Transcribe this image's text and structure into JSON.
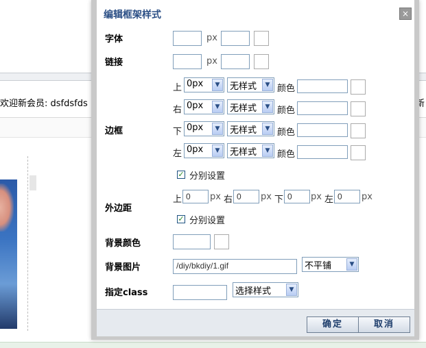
{
  "background": {
    "welcome_text": "欢迎新会员: dsfdsfds",
    "right_edge_text": "新"
  },
  "dialog": {
    "title": "编辑框架样式",
    "close_glyph": "×",
    "font": {
      "label": "字体",
      "unit": "px"
    },
    "link": {
      "label": "链接",
      "unit": "px"
    },
    "border": {
      "label": "边框",
      "rows": [
        {
          "side": "上",
          "size": "0px",
          "style": "无样式",
          "color_label": "颜色"
        },
        {
          "side": "右",
          "size": "0px",
          "style": "无样式",
          "color_label": "颜色"
        },
        {
          "side": "下",
          "size": "0px",
          "style": "无样式",
          "color_label": "颜色"
        },
        {
          "side": "左",
          "size": "0px",
          "style": "无样式",
          "color_label": "颜色"
        }
      ],
      "separate_label": "分别设置",
      "separate_checked": true
    },
    "margin": {
      "label": "外边距",
      "top_label": "上",
      "top_value": "0",
      "right_label": "右",
      "right_value": "0",
      "bottom_label": "下",
      "bottom_value": "0",
      "left_label": "左",
      "left_value": "0",
      "unit": "px",
      "separate_label": "分别设置",
      "separate_checked": true
    },
    "bg_color": {
      "label": "背景颜色"
    },
    "bg_image": {
      "label": "背景图片",
      "value": "/diy/bkdiy/1.gif",
      "repeat": "不平铺"
    },
    "css_class": {
      "label": "指定class",
      "select": "选择样式"
    },
    "confirm_label": "确定",
    "cancel_label": "取消"
  },
  "colors": {
    "title": "#2a4e85",
    "input_border": "#7f9db9",
    "footer_bg": "#e6eaef"
  }
}
